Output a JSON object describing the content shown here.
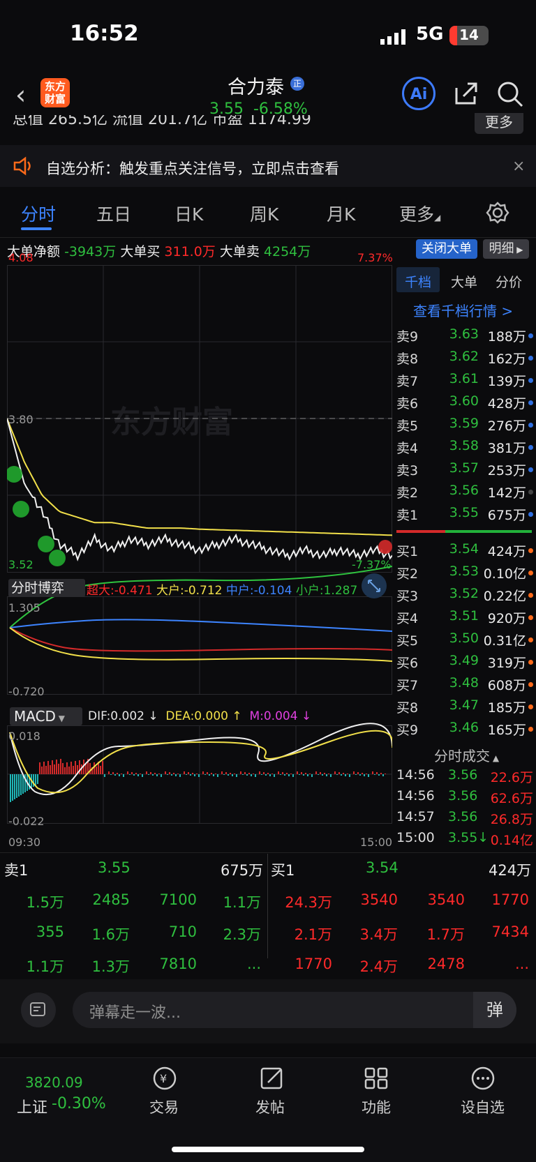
{
  "status_bar": {
    "time": "16:52",
    "network": "5G",
    "battery": "14"
  },
  "header": {
    "stock_name": "合力泰",
    "badge": "正",
    "price": "3.55",
    "change_pct": "-6.58%",
    "logo_line1": "东方",
    "logo_line2": "财富",
    "ai_label": "Ai"
  },
  "stats": {
    "text": "总值  265.5亿  流值  201.7亿  市盈  1174.99",
    "more": "更多"
  },
  "notice": {
    "text": "自选分析：触发重点关注信号，立即点击查看",
    "close": "×"
  },
  "tabs": [
    "分时",
    "五日",
    "日K",
    "周K",
    "月K",
    "更多"
  ],
  "big_order": {
    "net_label": "大单净额",
    "net_value": "-3943万",
    "buy_label": "大单买",
    "buy_value": "311.0万",
    "sell_label": "大单卖",
    "sell_value": "4254万",
    "close_btn": "关闭大单",
    "detail_btn": "明细"
  },
  "main_chart": {
    "price_high": "4.08",
    "pct_high": "7.37%",
    "price_ref": "3.80",
    "price_low": "3.52",
    "pct_low": "-7.37%",
    "watermark": "东方财富"
  },
  "chart_data": {
    "type": "line",
    "x_range": [
      "09:30",
      "15:00"
    ],
    "ylim": [
      3.52,
      4.08
    ],
    "reference": 3.8,
    "series": [],
    "price_approx": [
      3.8,
      3.68,
      3.63,
      3.57,
      3.55,
      3.58,
      3.56,
      3.58,
      3.57,
      3.58,
      3.57,
      3.56,
      3.57,
      3.58,
      3.57,
      3.56,
      3.55,
      3.56,
      3.55,
      3.56,
      3.55,
      3.56,
      3.55
    ],
    "avg_approx": [
      3.8,
      3.72,
      3.66,
      3.63,
      3.62,
      3.61,
      3.61,
      3.605,
      3.6,
      3.6,
      3.6,
      3.598,
      3.597,
      3.596,
      3.595,
      3.594,
      3.593,
      3.592,
      3.591,
      3.59,
      3.589,
      3.588,
      3.587
    ]
  },
  "sub_chart": {
    "label": "分时博弈",
    "super_label": "超大",
    "super_value": "-0.471",
    "large_label": "大户",
    "large_value": "-0.712",
    "mid_label": "中户",
    "mid_value": "-0.104",
    "small_label": "小户",
    "small_value": "1.287",
    "ymax": "1.305",
    "ymin": "-0.720"
  },
  "macd": {
    "label": "MACD",
    "dif": "DIF:0.002 ↓",
    "dea": "DEA:0.000 ↑",
    "m": "M:0.004 ↓",
    "ymax": "0.018",
    "ymin": "-0.022",
    "t_start": "09:30",
    "t_end": "15:00"
  },
  "order_book": {
    "tabs": [
      "千档",
      "大单",
      "分价"
    ],
    "link": "查看千档行情 >",
    "sell": [
      {
        "label": "卖9",
        "price": "3.63",
        "vol": "188万",
        "dot": "#2f6fe0"
      },
      {
        "label": "卖8",
        "price": "3.62",
        "vol": "162万",
        "dot": "#2f6fe0"
      },
      {
        "label": "卖7",
        "price": "3.61",
        "vol": "139万",
        "dot": "#2f6fe0"
      },
      {
        "label": "卖6",
        "price": "3.60",
        "vol": "428万",
        "dot": "#2f6fe0"
      },
      {
        "label": "卖5",
        "price": "3.59",
        "vol": "276万",
        "dot": "#2f6fe0"
      },
      {
        "label": "卖4",
        "price": "3.58",
        "vol": "381万",
        "dot": "#2f6fe0"
      },
      {
        "label": "卖3",
        "price": "3.57",
        "vol": "253万",
        "dot": "#2f6fe0"
      },
      {
        "label": "卖2",
        "price": "3.56",
        "vol": "142万",
        "dot": "#444444"
      },
      {
        "label": "卖1",
        "price": "3.55",
        "vol": "675万",
        "dot": "#2f6fe0"
      }
    ],
    "buy": [
      {
        "label": "买1",
        "price": "3.54",
        "vol": "424万",
        "dot": "#ff6a1a"
      },
      {
        "label": "买2",
        "price": "3.53",
        "vol": "0.10亿",
        "dot": "#ff6a1a"
      },
      {
        "label": "买3",
        "price": "3.52",
        "vol": "0.22亿",
        "dot": "#ff6a1a"
      },
      {
        "label": "买4",
        "price": "3.51",
        "vol": "920万",
        "dot": "#ff6a1a"
      },
      {
        "label": "买5",
        "price": "3.50",
        "vol": "0.31亿",
        "dot": "#ff6a1a"
      },
      {
        "label": "买6",
        "price": "3.49",
        "vol": "319万",
        "dot": "#ff6a1a"
      },
      {
        "label": "买7",
        "price": "3.48",
        "vol": "608万",
        "dot": "#ff6a1a"
      },
      {
        "label": "买8",
        "price": "3.47",
        "vol": "185万",
        "dot": "#ff6a1a"
      },
      {
        "label": "买9",
        "price": "3.46",
        "vol": "165万",
        "dot": "#ff6a1a"
      }
    ],
    "trades_title": "分时成交",
    "trades": [
      {
        "time": "14:56",
        "price": "3.56",
        "vol": "22.6万"
      },
      {
        "time": "14:56",
        "price": "3.56",
        "vol": "62.6万"
      },
      {
        "time": "14:57",
        "price": "3.56",
        "vol": "26.8万"
      },
      {
        "time": "15:00",
        "price": "3.55↓",
        "vol": "0.14亿"
      }
    ]
  },
  "bottom_book": {
    "sell1_label": "卖1",
    "sell1_price": "3.55",
    "sell1_vol": "675万",
    "buy1_label": "买1",
    "buy1_price": "3.54",
    "buy1_vol": "424万",
    "sell_rows": [
      [
        "1.5万",
        "2485",
        "7100",
        "1.1万"
      ],
      [
        "355",
        "1.6万",
        "710",
        "2.3万"
      ],
      [
        "1.1万",
        "1.3万",
        "7810",
        "..."
      ]
    ],
    "buy_rows": [
      [
        "24.3万",
        "3540",
        "3540",
        "1770"
      ],
      [
        "2.1万",
        "3.4万",
        "1.7万",
        "7434"
      ],
      [
        "1770",
        "2.4万",
        "2478",
        "..."
      ]
    ]
  },
  "comment": {
    "placeholder": "弹幕走一波...",
    "danmu": "弹"
  },
  "bottom_nav": {
    "index_value": "3820.09",
    "index_name": "上证",
    "index_pct": "-0.30%",
    "items": [
      "交易",
      "发帖",
      "功能",
      "设自选"
    ]
  }
}
